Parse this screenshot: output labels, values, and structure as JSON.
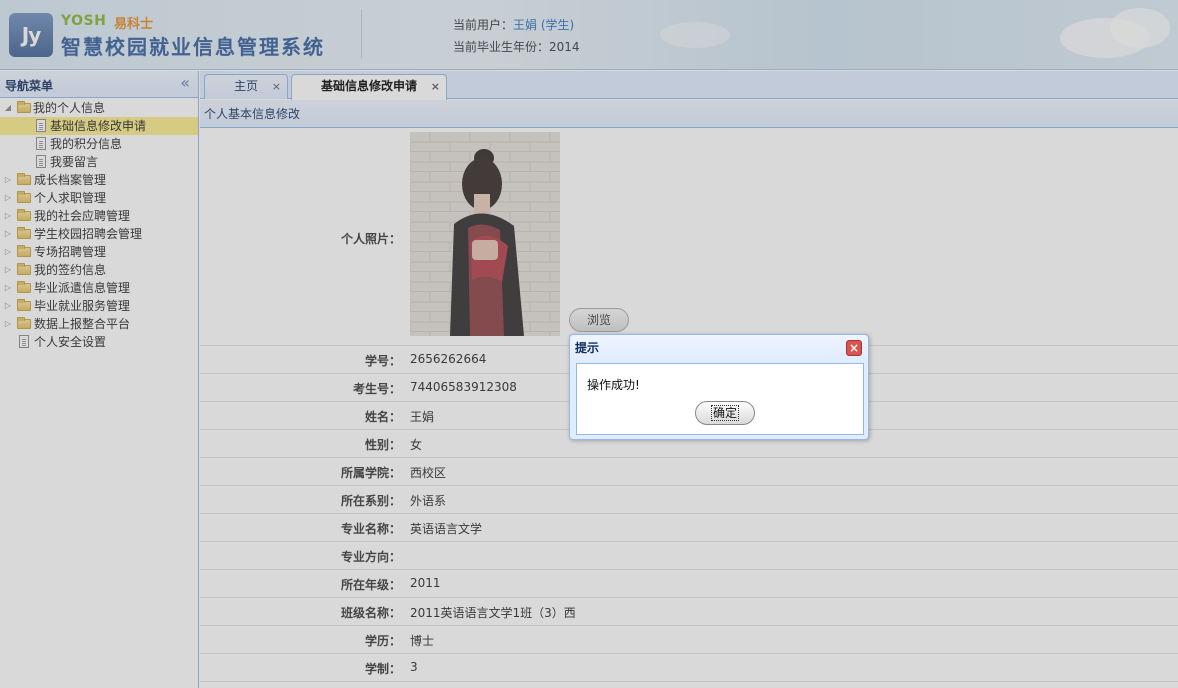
{
  "header": {
    "logo_text": "Jy",
    "brand_en": "YOSH",
    "brand_cn": "易科士",
    "system_title": "智慧校园就业信息管理系统",
    "current_user_label": "当前用户：",
    "current_user_name": "王娟 (学生)",
    "grad_year_label": "当前毕业生年份：",
    "grad_year_value": "2014"
  },
  "sidebar": {
    "title": "导航菜单",
    "items": [
      {
        "label": "我的个人信息",
        "type": "folder",
        "expanded": true
      },
      {
        "label": "基础信息修改申请",
        "type": "file",
        "selected": true
      },
      {
        "label": "我的积分信息",
        "type": "file"
      },
      {
        "label": "我要留言",
        "type": "file"
      },
      {
        "label": "成长档案管理",
        "type": "folder"
      },
      {
        "label": "个人求职管理",
        "type": "folder"
      },
      {
        "label": "我的社会应聘管理",
        "type": "folder"
      },
      {
        "label": "学生校园招聘会管理",
        "type": "folder"
      },
      {
        "label": "专场招聘管理",
        "type": "folder"
      },
      {
        "label": "我的签约信息",
        "type": "folder"
      },
      {
        "label": "毕业派遣信息管理",
        "type": "folder"
      },
      {
        "label": "毕业就业服务管理",
        "type": "folder"
      },
      {
        "label": "数据上报整合平台",
        "type": "folder"
      },
      {
        "label": "个人安全设置",
        "type": "file"
      }
    ]
  },
  "tabs": [
    {
      "label": "主页",
      "active": false
    },
    {
      "label": "基础信息修改申请",
      "active": true
    }
  ],
  "panel": {
    "title": "个人基本信息修改"
  },
  "form": {
    "photo_label": "个人照片：",
    "browse_label": "浏览",
    "fields": [
      {
        "label": "学号：",
        "value": "2656262664"
      },
      {
        "label": "考生号：",
        "value": "74406583912308"
      },
      {
        "label": "姓名：",
        "value": "王娟"
      },
      {
        "label": "性别：",
        "value": "女"
      },
      {
        "label": "所属学院：",
        "value": "西校区"
      },
      {
        "label": "所在系别：",
        "value": "外语系"
      },
      {
        "label": "专业名称：",
        "value": "英语语言文学"
      },
      {
        "label": "专业方向：",
        "value": ""
      },
      {
        "label": "所在年级：",
        "value": "2011"
      },
      {
        "label": "班级名称：",
        "value": "2011英语语言文学1班（3）西"
      },
      {
        "label": "学历：",
        "value": "博士"
      },
      {
        "label": "学制：",
        "value": "3"
      }
    ]
  },
  "dialog": {
    "title": "提示",
    "message": "操作成功!",
    "ok_label": "确定",
    "close_icon": "close-icon"
  },
  "colors": {
    "accent_border": "#95b8e7",
    "panel_header": "#e0ecff",
    "selected_row": "#fbec88",
    "user_link": "#2a6cc0"
  }
}
